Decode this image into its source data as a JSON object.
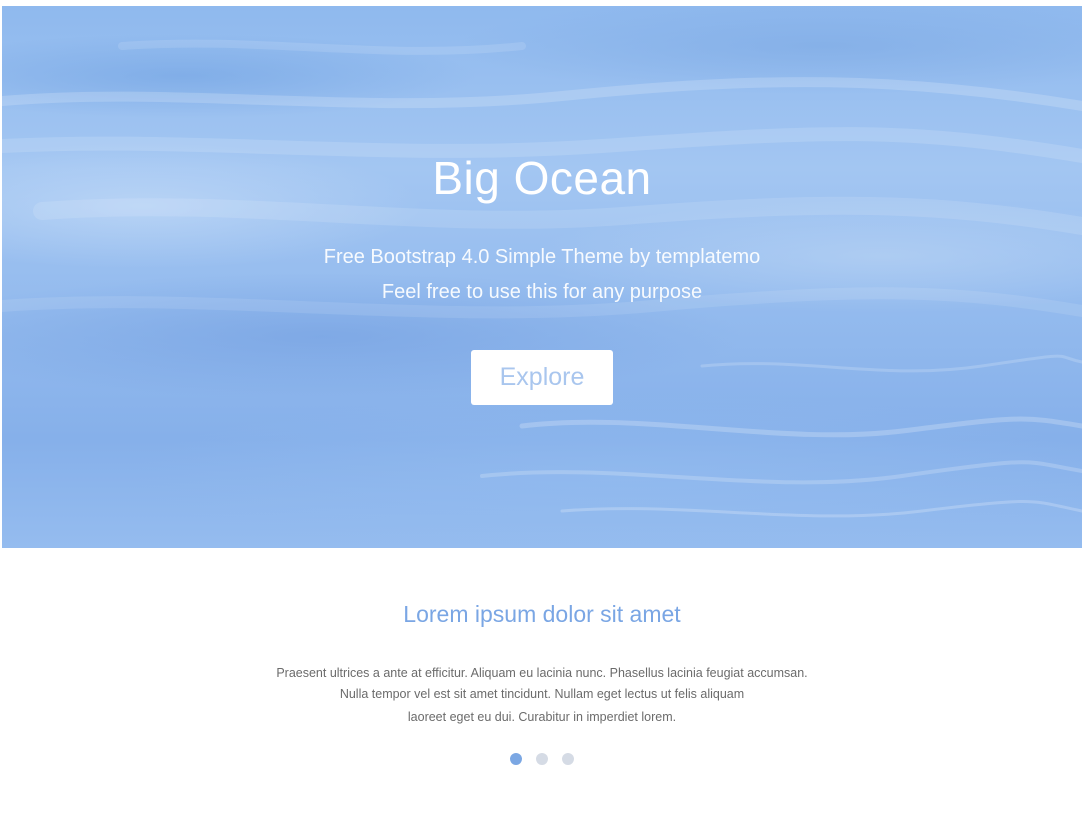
{
  "hero": {
    "title": "Big Ocean",
    "subtitle_line1": "Free Bootstrap 4.0 Simple Theme by templatemo",
    "subtitle_line2": "Feel free to use this for any purpose",
    "button_label": "Explore"
  },
  "section": {
    "title": "Lorem ipsum dolor sit amet",
    "text_line1": "Praesent ultrices a ante at efficitur. Aliquam eu lacinia nunc. Phasellus lacinia feugiat accumsan.",
    "text_line2": "Nulla tempor vel est sit amet tincidunt. Nullam eget lectus ut felis aliquam",
    "text_line3": "laoreet eget eu dui. Curabitur in imperdiet lorem."
  },
  "carousel": {
    "slide_count": 3,
    "active_index": 0
  },
  "colors": {
    "accent": "#7aa6e4",
    "hero_overlay": "#95bcef",
    "dot_inactive": "#d5dbe5",
    "button_text": "#a9c6ee"
  }
}
